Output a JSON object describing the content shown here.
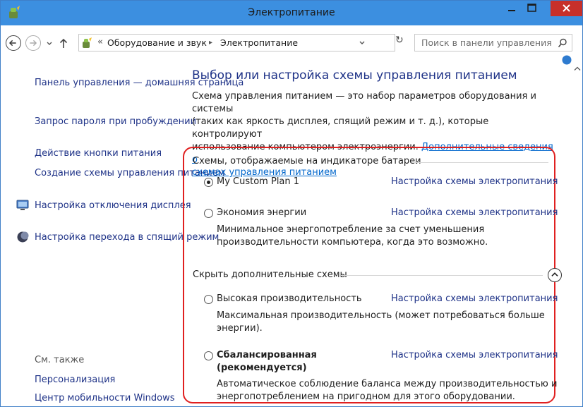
{
  "window": {
    "title": "Электропитание"
  },
  "address": {
    "sep": "«",
    "crumb1": "Оборудование и звук",
    "arrow": "▸",
    "crumb2": "Электропитание",
    "refresh": "↻"
  },
  "search": {
    "placeholder": "Поиск в панели управления"
  },
  "sidebar": {
    "home_line1": "Панель управления —",
    "home_line2": "домашняя страница",
    "password_line1": "Запрос пароля при",
    "password_line2": "пробуждении",
    "power_button": "Действие кнопки питания",
    "create_line1": "Создание схемы управления",
    "create_line2": "питанием",
    "display_line1": "Настройка отключения",
    "display_line2": "дисплея",
    "sleep_line1": "Настройка перехода в",
    "sleep_line2": "спящий режим",
    "see_also": "См. также",
    "personalization": "Персонализация",
    "mobility": "Центр мобильности Windows"
  },
  "main": {
    "heading": "Выбор или настройка схемы управления питанием",
    "desc_line1": "Схема управления питанием — это набор параметров оборудования и системы",
    "desc_line2": "(таких как яркость дисплея, спящий режим и т. д.), которые контролируют",
    "desc_line3a": "использование компьютером электроэнергии. ",
    "desc_link1": "Дополнительные сведения о",
    "desc_link2": "схемах управления питанием"
  },
  "groups": {
    "battery": "Схемы, отображаемые на индикаторе батареи",
    "hidden": "Скрыть дополнительные схемы"
  },
  "plans": {
    "custom": {
      "name": "My Custom Plan 1",
      "link": "Настройка схемы электропитания",
      "selected": true
    },
    "saver": {
      "name": "Экономия энергии",
      "link": "Настройка схемы электропитания",
      "desc1": "Минимальное энергопотребление за счет уменьшения",
      "desc2": "производительности компьютера, когда это возможно."
    },
    "high": {
      "name": "Высокая производительность",
      "link": "Настройка схемы электропитания",
      "desc1": "Максимальная производительность (может потребоваться больше",
      "desc2": "энергии)."
    },
    "balanced": {
      "name1": "Сбалансированная",
      "name2": "(рекомендуется)",
      "link": "Настройка схемы электропитания",
      "desc1": "Автоматическое соблюдение баланса между производительностью и",
      "desc2": "энергопотреблением на пригодном для этого оборудовании."
    }
  },
  "colors": {
    "titlebar": "#3c8fe0",
    "close": "#c7302a",
    "link": "#1e3287",
    "highlight": "#e02020"
  },
  "icons": [
    "power-options-icon",
    "back-icon",
    "forward-icon",
    "up-icon",
    "search-icon",
    "help-icon",
    "collapse-icon",
    "display-icon",
    "sleep-icon"
  ]
}
